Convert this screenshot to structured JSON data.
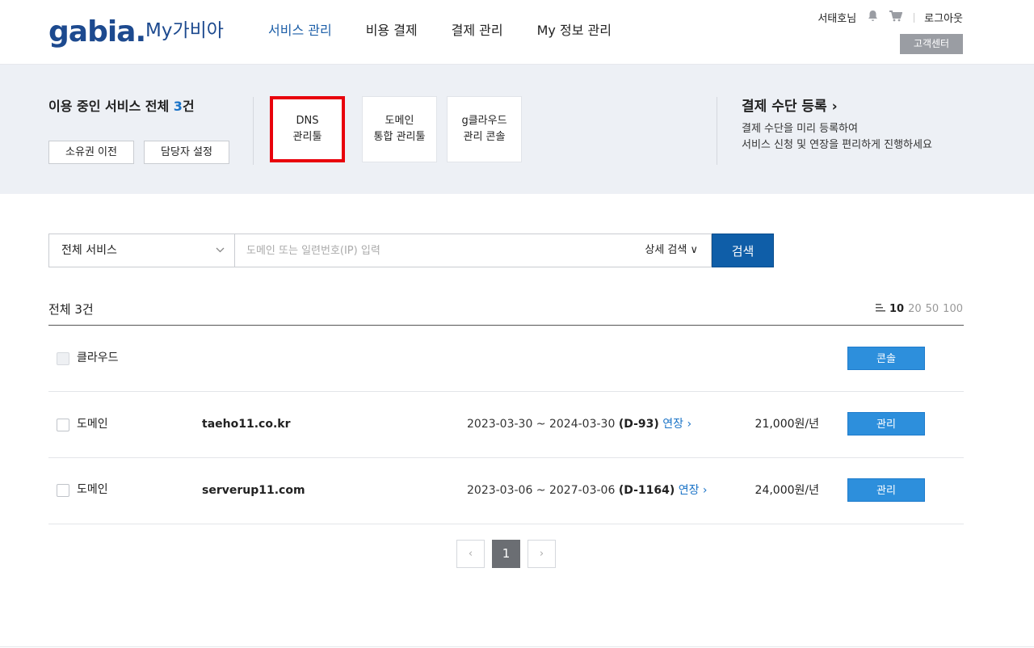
{
  "header": {
    "logo": "gabia.",
    "logo_sub": "My가비아",
    "nav": [
      "서비스 관리",
      "비용 결제",
      "결제 관리",
      "My 정보 관리"
    ],
    "user": "서태호님",
    "icons": [
      "bell-icon",
      "cart-icon"
    ],
    "logout": "로그아웃",
    "cs_center": "고객센터"
  },
  "summary": {
    "title_prefix": "이용 중인 서비스 전체 ",
    "count": "3",
    "title_suffix": "건",
    "btn_transfer": "소유권 이전",
    "btn_contact": "담당자 설정"
  },
  "tiles": [
    {
      "line1": "DNS",
      "line2": "관리툴"
    },
    {
      "line1": "도메인",
      "line2": "통합 관리툴"
    },
    {
      "line1": "g클라우드",
      "line2": "관리 콘솔"
    }
  ],
  "payment": {
    "title": "결제 수단 등록 ›",
    "desc1": "결제 수단을 미리 등록하여",
    "desc2": "서비스 신청 및 연장을 편리하게 진행하세요"
  },
  "search": {
    "select_value": "전체 서비스",
    "placeholder": "도메인 또는 일련번호(IP) 입력",
    "detail": "상세 검색 ∨",
    "button": "검색"
  },
  "list": {
    "total": "전체 3건",
    "page_sizes": [
      "10",
      "20",
      "50",
      "100"
    ],
    "active_size": "10",
    "rows": [
      {
        "type": "클라우드",
        "name": "",
        "period": "",
        "dday": "",
        "renew": "",
        "price": "",
        "button": "콘솔"
      },
      {
        "type": "도메인",
        "name": "taeho11.co.kr",
        "period": "2023-03-30 ~ 2024-03-30 ",
        "dday": "(D-93)",
        "renew": " 연장 ›",
        "price": "21,000원/년",
        "button": "관리"
      },
      {
        "type": "도메인",
        "name": "serverup11.com",
        "period": "2023-03-06 ~ 2027-03-06 ",
        "dday": "(D-1164)",
        "renew": " 연장 ›",
        "price": "24,000원/년",
        "button": "관리"
      }
    ]
  },
  "pager": {
    "prev": "‹",
    "current": "1",
    "next": "›"
  }
}
